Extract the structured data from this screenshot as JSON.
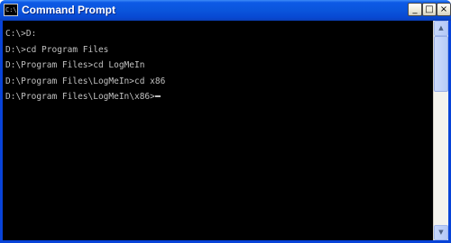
{
  "window": {
    "title": "Command Prompt",
    "icon_text": "C:\\",
    "controls": {
      "minimize": "_",
      "maximize": "□",
      "close": "×"
    }
  },
  "console": {
    "lines": [
      "C:\\>D:",
      "D:\\>cd Program Files",
      "D:\\Program Files>cd LogMeIn",
      "D:\\Program Files\\LogMeIn>cd x86",
      "D:\\Program Files\\LogMeIn\\x86>"
    ]
  },
  "scrollbar": {
    "up_arrow": "▲",
    "down_arrow": "▼"
  }
}
